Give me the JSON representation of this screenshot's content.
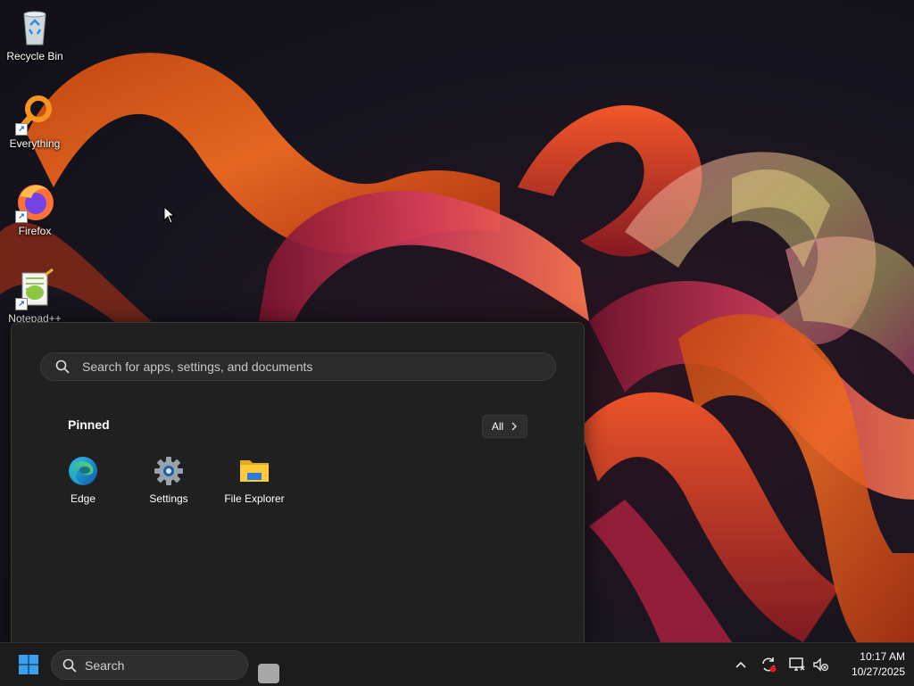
{
  "desktop": {
    "icons": [
      {
        "label": "Recycle Bin",
        "icon": "recycle-bin-icon"
      },
      {
        "label": "Everything",
        "icon": "everything-search-icon"
      },
      {
        "label": "Firefox",
        "icon": "firefox-icon"
      },
      {
        "label": "Notepad++",
        "icon": "notepad-plus-plus-icon"
      }
    ]
  },
  "start_menu": {
    "search_placeholder": "Search for apps, settings, and documents",
    "pinned_title": "Pinned",
    "all_button": "All",
    "pinned": [
      {
        "label": "Edge",
        "icon": "edge-icon"
      },
      {
        "label": "Settings",
        "icon": "settings-gear-icon"
      },
      {
        "label": "File Explorer",
        "icon": "file-explorer-icon"
      }
    ]
  },
  "taskbar": {
    "search_label": "Search",
    "tray_icons": [
      "chevron-up-icon",
      "sync-icon",
      "network-icon",
      "volume-muted-icon"
    ],
    "time": "10:17 AM",
    "date": "10/27/2025"
  },
  "colors": {
    "wallpaper_orange": "#e8561f",
    "wallpaper_magenta": "#c0245a",
    "start_bg": "#202020",
    "taskbar_bg": "#1c1c1c",
    "windows_blue": "#3aa0f0"
  }
}
